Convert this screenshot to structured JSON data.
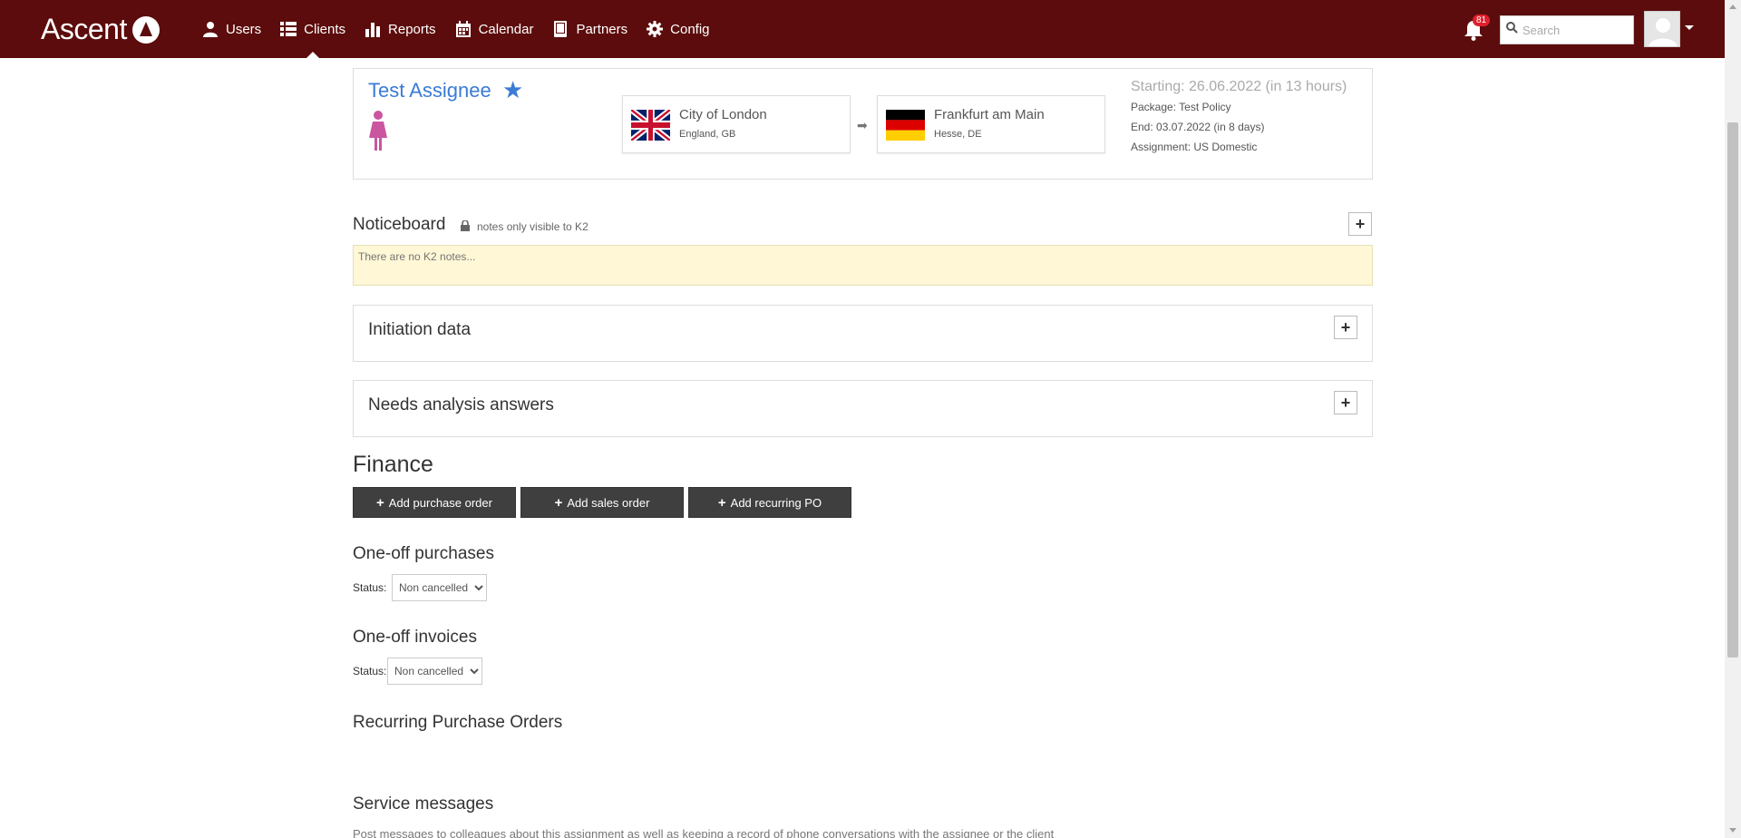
{
  "app": {
    "name": "Ascent"
  },
  "nav": [
    {
      "label": "Users",
      "icon": "user-icon"
    },
    {
      "label": "Clients",
      "icon": "list-icon",
      "active": true
    },
    {
      "label": "Reports",
      "icon": "bar-chart-icon"
    },
    {
      "label": "Calendar",
      "icon": "calendar-icon"
    },
    {
      "label": "Partners",
      "icon": "book-icon"
    },
    {
      "label": "Config",
      "icon": "gear-icon"
    }
  ],
  "header": {
    "notification_count": "81",
    "search_placeholder": "Search"
  },
  "assignee": {
    "name": "Test Assignee",
    "origin": {
      "city": "City of London",
      "region": "England, GB",
      "flag": "GB"
    },
    "destination": {
      "city": "Frankfurt am Main",
      "region": "Hesse, DE",
      "flag": "DE"
    },
    "starting": "Starting: 26.06.2022 (in 13 hours)",
    "package": "Package:  Test Policy",
    "end": "End:  03.07.2022 (in 8 days)",
    "assignment": "Assignment:  US Domestic"
  },
  "noticeboard": {
    "title": "Noticeboard",
    "subtitle": "notes only visible to K2",
    "placeholder": "There are no K2 notes..."
  },
  "panels": {
    "initiation": "Initiation data",
    "needs_analysis": "Needs analysis answers"
  },
  "finance": {
    "title": "Finance",
    "buttons": {
      "add_po": "Add purchase order",
      "add_so": "Add sales order",
      "add_recurring": "Add recurring PO"
    },
    "purchases": {
      "title": "One-off purchases",
      "status_label": "Status:",
      "status_value": "Non cancelled"
    },
    "invoices": {
      "title": "One-off invoices",
      "status_label": "Status:",
      "status_value": "Non cancelled"
    },
    "recurring_title": "Recurring Purchase Orders"
  },
  "service": {
    "title": "Service messages",
    "subtitle": "Post messages to colleagues about this assignment as well as keeping a record of phone conversations with the assignee or the client"
  },
  "colors": {
    "topbar": "#5c0c0c",
    "link": "#3a7bd5",
    "female_icon": "#c9569e",
    "notice_bg": "#fff7d6",
    "dark_button": "#3f3f3f",
    "badge": "#e0202c"
  }
}
